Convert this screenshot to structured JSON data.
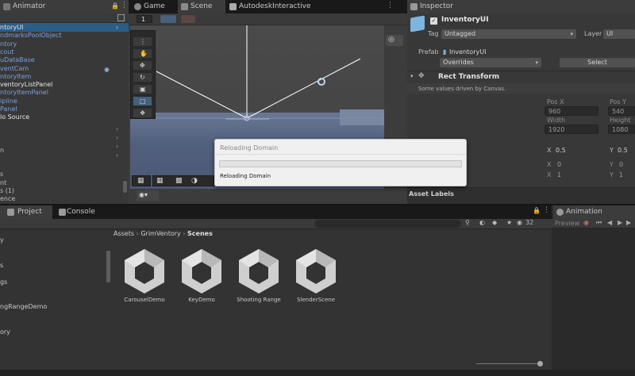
{
  "colors": {
    "panel": "#383838",
    "dark": "#191919",
    "scene_sky": "#454545",
    "scene_ground": "#5a6c8c",
    "selection_blue": "#46607c",
    "prefab_blue": "#7d9fdc"
  },
  "tabs": {
    "animator": "Animator",
    "game": "Game",
    "scene": "Scene",
    "autodesk": "AutodeskInteractive",
    "inspector": "Inspector",
    "project": "Project",
    "console": "Console",
    "animation": "Animation"
  },
  "hierarchy": {
    "items": [
      {
        "label": "ntoryUI",
        "style": "white"
      },
      {
        "label": "ndmarksPoolObject",
        "style": "blue"
      },
      {
        "label": "ntory",
        "style": "blue"
      },
      {
        "label": "cout",
        "style": "blue"
      },
      {
        "label": "uDataBase",
        "style": "blue"
      },
      {
        "label": "ventCam",
        "style": "blue"
      },
      {
        "label": "ntoryItem",
        "style": "blue"
      },
      {
        "label": "ventoryListPanel",
        "style": "white"
      },
      {
        "label": "ntoryItemPanel",
        "style": "blue"
      },
      {
        "label": "ipline",
        "style": "blue"
      },
      {
        "label": "Panel",
        "style": "blue"
      },
      {
        "label": "lo Source",
        "style": "white"
      },
      {
        "label": "",
        "style": "gray"
      },
      {
        "label": "",
        "style": "gray"
      },
      {
        "label": "",
        "style": "gray"
      },
      {
        "label": "n",
        "style": "gray"
      },
      {
        "label": "",
        "style": "gray"
      },
      {
        "label": "",
        "style": "gray"
      },
      {
        "label": "s",
        "style": "gray"
      },
      {
        "label": "nt",
        "style": "gray"
      },
      {
        "label": "s (1)",
        "style": "gray"
      },
      {
        "label": "ence",
        "style": "gray"
      }
    ]
  },
  "scene": {
    "view_number": "1"
  },
  "inspector": {
    "object_name": "InventoryUI",
    "tag_label": "Tag",
    "tag_value": "Untagged",
    "layer_label": "Layer",
    "layer_value": "UI",
    "prefab_label": "Prefab",
    "prefab_value": "InventoryUI",
    "overrides": "Overrides",
    "select": "Select",
    "rect_transform": "Rect Transform",
    "driven_note": "Some values driven by Canvas.",
    "pos_x_label": "Pos X",
    "pos_y_label": "Pos Y",
    "pos_x": "960",
    "pos_y": "540",
    "width_label": "Width",
    "height_label": "Height",
    "width": "1920",
    "height": "1080",
    "pivot_x_label": "X",
    "pivot_x": "0.5",
    "pivot_y_label": "Y",
    "pivot_y": "0.5",
    "rot_x_label": "X",
    "rot_x": "0",
    "rot_y_label": "Y",
    "rot_y": "0",
    "scale_x_label": "X",
    "scale_x": "1",
    "scale_y_label": "Y",
    "scale_y": "1",
    "asset_labels": "Asset Labels"
  },
  "dialog": {
    "title": "Reloading Domain",
    "status": "Reloading Domain",
    "progress": 0.0
  },
  "project": {
    "breadcrumb": [
      "Assets",
      "GrimVentory",
      "Scenes"
    ],
    "visible_count": "32",
    "left_items": [
      "y",
      "s",
      "gs",
      "ngRangeDemo",
      "ory"
    ],
    "assets": [
      "CarouselDemo",
      "KeyDemo",
      "Shooting Range",
      "SlenderScene"
    ]
  },
  "animation": {
    "preview_label": "Preview"
  }
}
